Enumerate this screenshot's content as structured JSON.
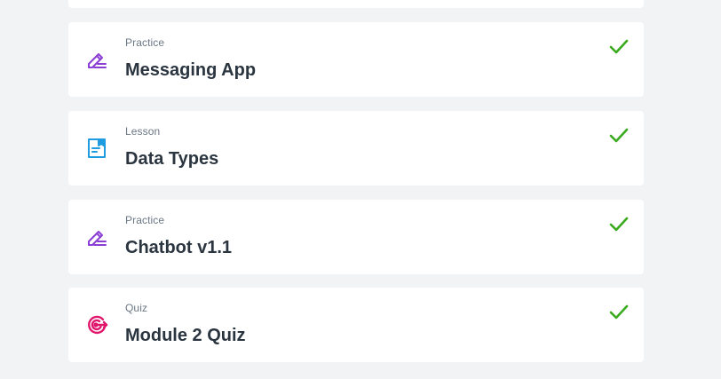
{
  "items": [
    {
      "type": "Practice",
      "title": "Messaging App",
      "icon": "pencil-edit-icon",
      "completed": true
    },
    {
      "type": "Lesson",
      "title": "Data Types",
      "icon": "lesson-document-icon",
      "completed": true
    },
    {
      "type": "Practice",
      "title": "Chatbot v1.1",
      "icon": "pencil-edit-icon",
      "completed": true
    },
    {
      "type": "Quiz",
      "title": "Module 2 Quiz",
      "icon": "target-icon",
      "completed": true
    }
  ],
  "colors": {
    "background": "#f1f3f5",
    "card": "#ffffff",
    "practice_icon": "#8a3ed4",
    "lesson_icon": "#1f9be0",
    "quiz_icon": "#e0156b",
    "check": "#3aaa1e",
    "title_text": "#2b3540",
    "type_text": "#6b7785"
  }
}
